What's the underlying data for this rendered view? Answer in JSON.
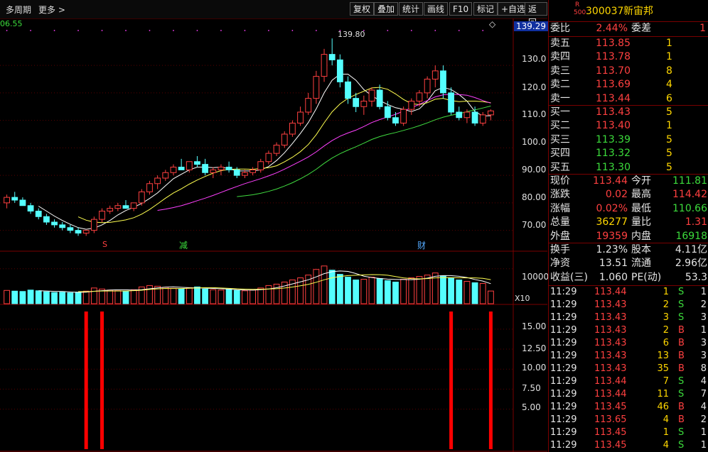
{
  "toolbar": {
    "period_label": "多周期",
    "more_label": "更多",
    "more_icon": "chevron-right-icon",
    "buttons": [
      "复权",
      "叠加",
      "统计",
      "画线",
      "F10",
      "标记",
      "+自选",
      "返回"
    ]
  },
  "chart": {
    "top_left_value": "06.55",
    "current_price_tag": "139.29",
    "high_marker": "139.80",
    "price_ticks": [
      "130.0",
      "120.0",
      "110.0",
      "100.0",
      "90.00",
      "80.00",
      "70.00"
    ],
    "event_markers": [
      "S",
      "减",
      "财"
    ],
    "volume_tick": "10000",
    "volume_unit": "X10",
    "indicator_ticks": [
      "15.00",
      "12.50",
      "10.00",
      "7.50",
      "5.00"
    ],
    "colors": {
      "up": "#ff4040",
      "down": "#54ffff",
      "ma5": "#ffffff",
      "ma10": "#ffff50",
      "ma20": "#ff40ff",
      "ma60": "#40dc40",
      "grid": "#5a0000"
    }
  },
  "chart_data": {
    "type": "candlestick",
    "candles": [
      [
        80,
        83,
        78,
        82
      ],
      [
        82,
        84,
        80,
        81
      ],
      [
        81,
        82,
        79,
        79
      ],
      [
        79,
        80,
        76,
        77
      ],
      [
        77,
        78,
        74,
        75
      ],
      [
        75,
        76,
        72,
        73
      ],
      [
        73,
        74,
        71,
        72
      ],
      [
        72,
        73,
        70,
        71
      ],
      [
        71,
        72,
        69,
        70
      ],
      [
        70,
        71,
        68,
        69
      ],
      [
        69,
        70,
        68,
        70
      ],
      [
        70,
        75,
        69,
        74
      ],
      [
        74,
        78,
        73,
        77
      ],
      [
        77,
        79,
        76,
        78
      ],
      [
        78,
        80,
        77,
        79
      ],
      [
        79,
        81,
        78,
        78
      ],
      [
        78,
        80,
        77,
        80
      ],
      [
        80,
        85,
        79,
        84
      ],
      [
        84,
        88,
        83,
        87
      ],
      [
        87,
        90,
        85,
        89
      ],
      [
        89,
        92,
        88,
        91
      ],
      [
        91,
        94,
        90,
        93
      ],
      [
        93,
        96,
        92,
        92
      ],
      [
        92,
        95,
        91,
        95
      ],
      [
        95,
        97,
        93,
        94
      ],
      [
        94,
        96,
        90,
        91
      ],
      [
        91,
        93,
        89,
        92
      ],
      [
        92,
        94,
        90,
        93
      ],
      [
        93,
        95,
        91,
        92
      ],
      [
        92,
        93,
        89,
        90
      ],
      [
        90,
        92,
        89,
        91
      ],
      [
        91,
        93,
        90,
        92
      ],
      [
        92,
        96,
        91,
        95
      ],
      [
        95,
        99,
        94,
        98
      ],
      [
        98,
        102,
        97,
        101
      ],
      [
        101,
        106,
        100,
        105
      ],
      [
        105,
        110,
        104,
        109
      ],
      [
        109,
        115,
        108,
        113
      ],
      [
        113,
        120,
        112,
        118
      ],
      [
        118,
        128,
        116,
        126
      ],
      [
        126,
        136,
        124,
        134
      ],
      [
        134,
        139.8,
        130,
        132
      ],
      [
        132,
        134,
        122,
        124
      ],
      [
        124,
        126,
        116,
        118
      ],
      [
        118,
        120,
        113,
        115
      ],
      [
        115,
        119,
        112,
        117
      ],
      [
        117,
        122,
        115,
        121
      ],
      [
        121,
        123,
        114,
        115
      ],
      [
        115,
        117,
        110,
        111
      ],
      [
        111,
        113,
        108,
        109
      ],
      [
        109,
        115,
        108,
        114
      ],
      [
        114,
        118,
        112,
        117
      ],
      [
        117,
        121,
        115,
        120
      ],
      [
        120,
        126,
        118,
        125
      ],
      [
        125,
        130,
        122,
        128
      ],
      [
        128,
        130,
        118,
        120
      ],
      [
        120,
        122,
        112,
        113
      ],
      [
        113,
        115,
        110,
        111
      ],
      [
        111,
        114,
        109,
        113
      ],
      [
        113,
        115,
        108,
        109
      ],
      [
        109,
        113,
        108,
        112
      ],
      [
        112,
        114,
        110,
        113.44
      ]
    ],
    "volume": [
      3800,
      3600,
      3500,
      3900,
      3700,
      3400,
      3200,
      3300,
      3100,
      3300,
      3600,
      4500,
      4200,
      3900,
      3700,
      3600,
      4000,
      4800,
      5200,
      5000,
      4700,
      4400,
      4200,
      4600,
      4800,
      4200,
      4000,
      3900,
      4100,
      3800,
      3700,
      3900,
      4500,
      5200,
      5600,
      6200,
      6800,
      7400,
      8200,
      9800,
      10800,
      9600,
      8400,
      7600,
      6800,
      7000,
      7600,
      7200,
      6600,
      6200,
      7000,
      7400,
      7800,
      8200,
      8800,
      8000,
      7400,
      6800,
      6400,
      6000,
      5800,
      3628
    ],
    "indicator_spikes": [
      {
        "index": 10,
        "value": 17.2
      },
      {
        "index": 12,
        "value": 17.2
      },
      {
        "index": 56,
        "value": 17.2
      },
      {
        "index": 61,
        "value": 17.2
      }
    ],
    "ylim_price": [
      65,
      145
    ],
    "ylim_volume": [
      0,
      13000
    ],
    "ylim_indicator": [
      0,
      18
    ]
  },
  "quote": {
    "tag_top": "R",
    "tag_bottom": "500",
    "code": "300037",
    "name": "新宙邦",
    "weibi_label": "委比",
    "weibi_value": "2.44%",
    "weicha_label": "委差",
    "weicha_value": "1",
    "asks": [
      {
        "label": "卖五",
        "price": "113.85",
        "vol": "1"
      },
      {
        "label": "卖四",
        "price": "113.78",
        "vol": "1"
      },
      {
        "label": "卖三",
        "price": "113.70",
        "vol": "8"
      },
      {
        "label": "卖二",
        "price": "113.69",
        "vol": "4"
      },
      {
        "label": "卖一",
        "price": "113.44",
        "vol": "6"
      }
    ],
    "bids": [
      {
        "label": "买一",
        "price": "113.43",
        "vol": "5"
      },
      {
        "label": "买二",
        "price": "113.40",
        "vol": "1"
      },
      {
        "label": "买三",
        "price": "113.39",
        "vol": "5"
      },
      {
        "label": "买四",
        "price": "113.32",
        "vol": "5"
      },
      {
        "label": "买五",
        "price": "113.30",
        "vol": "5"
      }
    ],
    "stats": [
      {
        "l1": "现价",
        "v1": "113.44",
        "c1": "red",
        "l2": "今开",
        "v2": "111.81",
        "c2": "grn"
      },
      {
        "l1": "涨跌",
        "v1": "0.02",
        "c1": "red",
        "l2": "最高",
        "v2": "114.42",
        "c2": "red"
      },
      {
        "l1": "涨幅",
        "v1": "0.02%",
        "c1": "red",
        "l2": "最低",
        "v2": "110.66",
        "c2": "grn"
      },
      {
        "l1": "总量",
        "v1": "36277",
        "c1": "yel",
        "l2": "量比",
        "v2": "1.31",
        "c2": "red"
      },
      {
        "l1": "外盘",
        "v1": "19359",
        "c1": "red",
        "l2": "内盘",
        "v2": "16918",
        "c2": "grn"
      }
    ],
    "fund": [
      {
        "l1": "换手",
        "v1": "1.23%",
        "l2": "股本",
        "v2": "4.11亿"
      },
      {
        "l1": "净资",
        "v1": "13.51",
        "l2": "流通",
        "v2": "2.96亿"
      },
      {
        "l1": "收益(三)",
        "v1": "1.060",
        "l2": "PE(动)",
        "v2": "53.3"
      }
    ],
    "ticks": [
      {
        "t": "11:29",
        "p": "113.44",
        "pc": "red",
        "v": "1",
        "s": "S",
        "n": "1"
      },
      {
        "t": "11:29",
        "p": "113.43",
        "pc": "red",
        "v": "2",
        "s": "S",
        "n": "2"
      },
      {
        "t": "11:29",
        "p": "113.43",
        "pc": "red",
        "v": "3",
        "s": "S",
        "n": "3"
      },
      {
        "t": "11:29",
        "p": "113.43",
        "pc": "red",
        "v": "2",
        "s": "B",
        "n": "1"
      },
      {
        "t": "11:29",
        "p": "113.43",
        "pc": "red",
        "v": "6",
        "s": "B",
        "n": "3"
      },
      {
        "t": "11:29",
        "p": "113.43",
        "pc": "red",
        "v": "13",
        "s": "B",
        "n": "3"
      },
      {
        "t": "11:29",
        "p": "113.43",
        "pc": "red",
        "v": "35",
        "s": "B",
        "n": "8"
      },
      {
        "t": "11:29",
        "p": "113.44",
        "pc": "red",
        "v": "7",
        "s": "S",
        "n": "4"
      },
      {
        "t": "11:29",
        "p": "113.44",
        "pc": "red",
        "v": "11",
        "s": "S",
        "n": "7"
      },
      {
        "t": "11:29",
        "p": "113.45",
        "pc": "red",
        "v": "46",
        "s": "B",
        "n": "4"
      },
      {
        "t": "11:29",
        "p": "113.65",
        "pc": "red",
        "v": "4",
        "s": "B",
        "n": "2"
      },
      {
        "t": "11:29",
        "p": "113.45",
        "pc": "red",
        "v": "1",
        "s": "S",
        "n": "1"
      },
      {
        "t": "11:29",
        "p": "113.45",
        "pc": "red",
        "v": "4",
        "s": "S",
        "n": "1"
      }
    ]
  }
}
